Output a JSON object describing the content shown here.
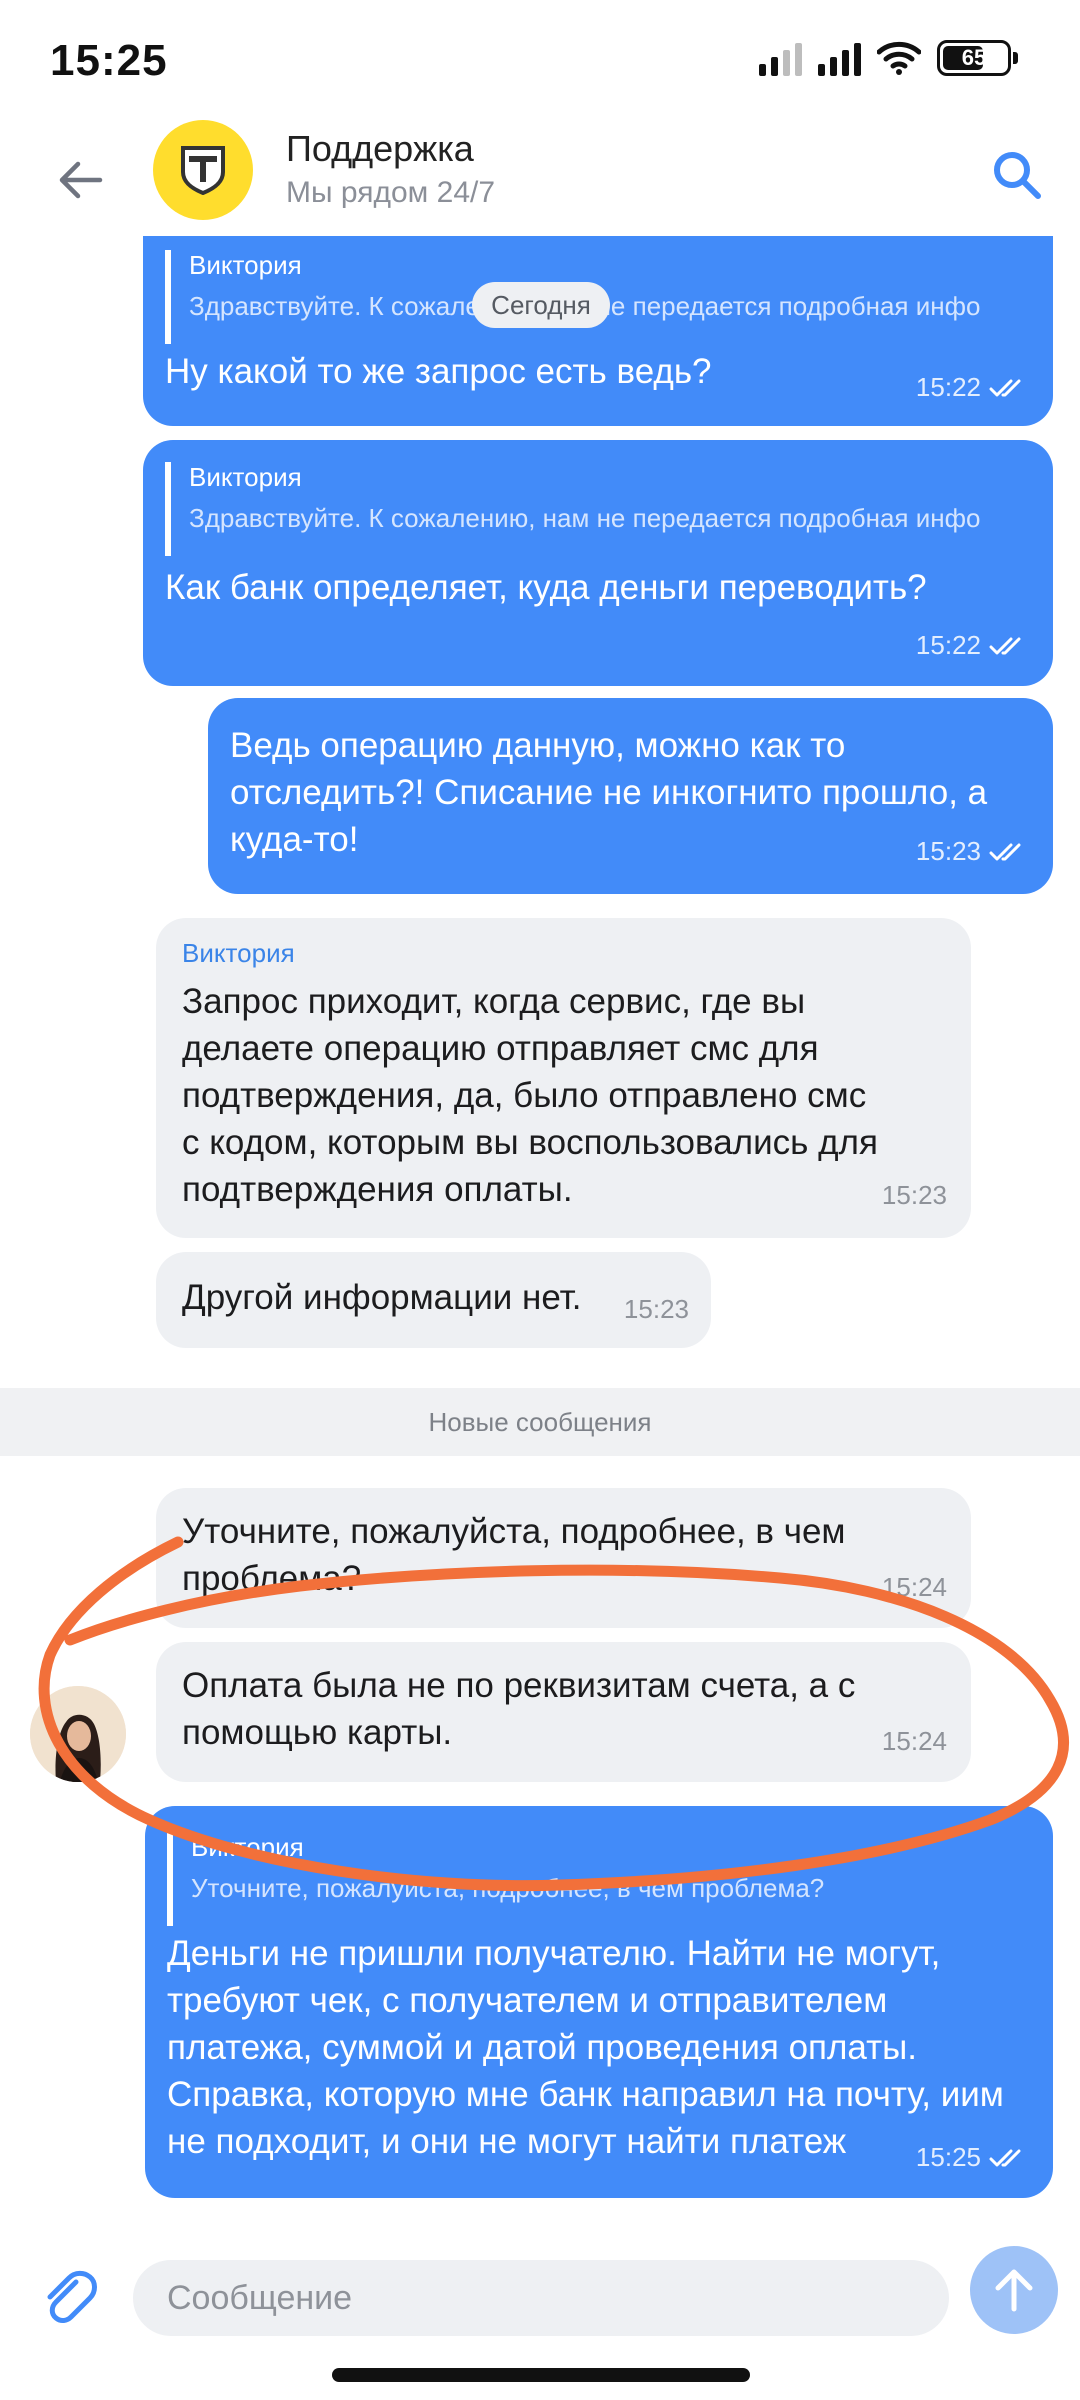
{
  "status_bar": {
    "time": "15:25",
    "battery": "65"
  },
  "header": {
    "title": "Поддержка",
    "subtitle": "Мы рядом 24/7",
    "logo_letter": "T"
  },
  "chat": {
    "date_label": "Сегодня",
    "new_messages_label": "Новые сообщения",
    "messages": [
      {
        "direction": "out",
        "quote_author": "Виктория",
        "quote_text": "Здравствуйте. К сожалению, нам не передается подробная инфо",
        "text": "Ну какой то же запрос есть ведь?",
        "time": "15:22"
      },
      {
        "direction": "out",
        "quote_author": "Виктория",
        "quote_text": "Здравствуйте. К сожалению, нам не передается подробная инфо",
        "text": "Как банк определяет, куда деньги переводить?",
        "time": "15:22"
      },
      {
        "direction": "out",
        "text": "Ведь операцию данную, можно как то отследить?! Списание не инкогнито прошло, а куда-то!",
        "time": "15:23"
      },
      {
        "direction": "in",
        "sender": "Виктория",
        "text": "Запрос приходит, когда сервис, где вы делаете операцию отправляет смс для подтверждения, да, было отправлено смс с кодом, которым вы воспользовались для подтверждения оплаты.",
        "time": "15:23"
      },
      {
        "direction": "in",
        "text": "Другой информации нет.",
        "time": "15:23"
      },
      {
        "direction": "in",
        "text": "Уточните, пожалуйста, подробнее, в чем проблема?",
        "time": "15:24"
      },
      {
        "direction": "in",
        "text": "Оплата была не по реквизитам счета, а с помощью карты.",
        "time": "15:24"
      },
      {
        "direction": "out",
        "quote_author": "Виктория",
        "quote_text": "Уточните, пожалуйста, подробнее, в чем проблема?",
        "text": "Деньги не пришли получателю. Найти не могут, требуют чек, с получателем и отправителем платежа, суммой и датой проведения оплаты. Справка, которую мне банк направил на почту, иим не подходит, и они не могут найти платеж",
        "time": "15:25"
      }
    ]
  },
  "composer": {
    "placeholder": "Сообщение"
  },
  "colors": {
    "outgoing_bubble": "#428bf9",
    "incoming_bubble": "#eef0f3",
    "logo_yellow": "#ffdd2d",
    "annotation": "#f2703a"
  }
}
